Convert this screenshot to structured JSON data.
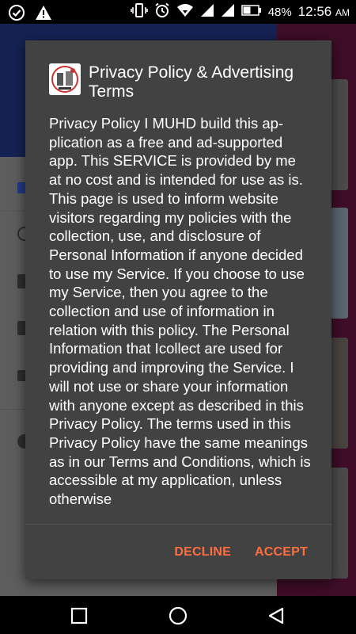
{
  "status_bar": {
    "battery_percent": "48%",
    "time": "12:56",
    "ampm": "AM",
    "left_icons": [
      "check-circle-icon",
      "warning-icon"
    ],
    "right_icons": [
      "vibrate-icon",
      "alarm-icon",
      "wifi-icon",
      "signal-icon",
      "signal-icon",
      "battery-icon"
    ]
  },
  "dialog": {
    "title": "Privacy Policy & Advertising Terms",
    "body": "Privacy Policy I MUHD build this ap-plication as a free and ad-supported app. This SERVICE is provided by me at no cost and is intended for use as is. This page is used to inform website visitors regarding my policies with the collection, use, and disclosure of Personal Information if anyone decided to use my Service. If you choose to use my Service, then you agree to the collection and use of information in relation with this policy. The Personal Information that Icollect are used for providing and improving the Service. I will not use or share your information with anyone except as described in this Privacy Policy. The terms used in this Privacy Policy have the same meanings as in our Terms and Conditions, which is accessible at my application, unless otherwise",
    "decline_label": "DECLINE",
    "accept_label": "ACCEPT"
  },
  "navbar": {
    "icons": [
      "recents-square-icon",
      "home-circle-icon",
      "back-triangle-icon"
    ]
  },
  "colors": {
    "dialog_bg": "#424242",
    "accent": "#ff6e40",
    "drawer_header": "#152254",
    "content_bg": "#3f0d28"
  }
}
